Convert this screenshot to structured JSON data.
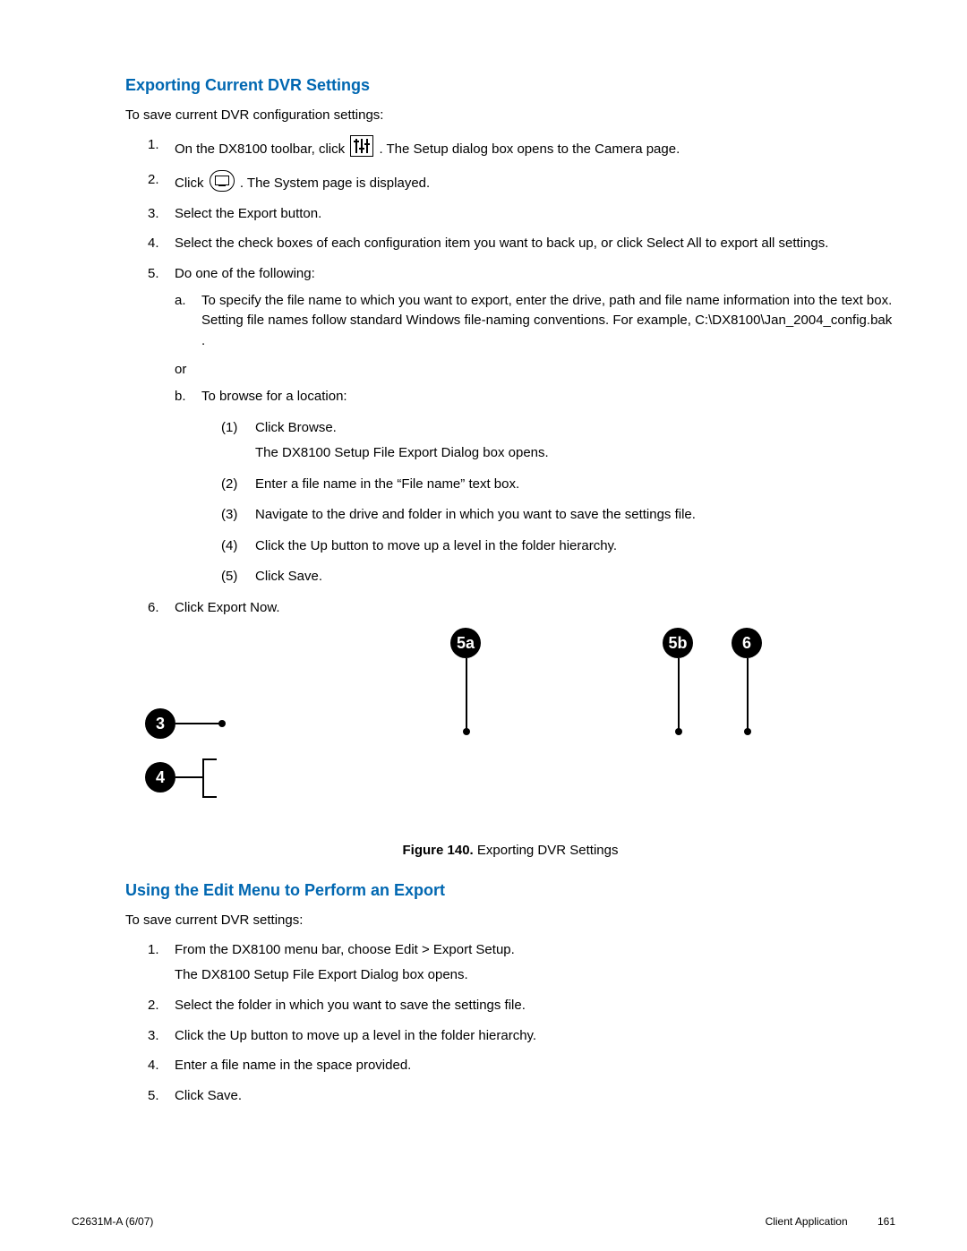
{
  "section1": {
    "title": "Exporting Current DVR Settings",
    "lead": "To save current DVR configuration settings:",
    "steps": [
      {
        "num": "1.",
        "pre": "On the DX8100 toolbar, click ",
        "post": ". The Setup dialog box opens to the Camera page.",
        "icon": "sliders"
      },
      {
        "num": "2.",
        "pre": "Click ",
        "post": ". The System page is displayed.",
        "icon": "monitor"
      },
      {
        "num": "3.",
        "text": "Select the Export button."
      },
      {
        "num": "4.",
        "text": "Select the check boxes of each configuration item you want to back up, or click Select All to export all settings."
      },
      {
        "num": "5.",
        "text": "Do one of the following:",
        "sub": {
          "a": {
            "num": "a.",
            "text": "To specify the file name to which you want to export, enter the drive, path and file name information into the text box. Setting file names follow standard Windows file-naming conventions. For example, C:\\DX8100\\Jan_2004_config.bak ."
          },
          "or": "or",
          "b": {
            "num": "b.",
            "text": "To browse for a location:",
            "paren": [
              {
                "num": "(1)",
                "text": "Click Browse.",
                "extra": "The DX8100 Setup File Export Dialog box opens."
              },
              {
                "num": "(2)",
                "text": "Enter a file name in the “File name” text box."
              },
              {
                "num": "(3)",
                "text": "Navigate to the drive and folder in which you want to save the settings file."
              },
              {
                "num": "(4)",
                "text": "Click the Up button to move up a level in the folder hierarchy."
              },
              {
                "num": "(5)",
                "text": "Click Save."
              }
            ]
          }
        }
      },
      {
        "num": "6.",
        "text": "Click Export Now."
      }
    ]
  },
  "figure": {
    "labels": {
      "c3": "3",
      "c4": "4",
      "c5a": "5a",
      "c5b": "5b",
      "c6": "6"
    },
    "caption_label": "Figure 140.",
    "caption_text": "  Exporting DVR Settings"
  },
  "section2": {
    "title": "Using the Edit Menu to Perform an Export",
    "lead": "To save current DVR settings:",
    "steps": [
      {
        "num": "1.",
        "text": "From the DX8100 menu bar, choose Edit > Export Setup.",
        "extra": "The DX8100 Setup File Export Dialog box opens."
      },
      {
        "num": "2.",
        "text": "Select the folder in which you want to save the settings file."
      },
      {
        "num": "3.",
        "text": "Click the Up button to move up a level in the folder hierarchy."
      },
      {
        "num": "4.",
        "text": "Enter a file name in the space provided."
      },
      {
        "num": "5.",
        "text": "Click Save."
      }
    ]
  },
  "footer": {
    "left": "C2631M-A (6/07)",
    "right_label": "Client Application",
    "right_page": "161"
  }
}
